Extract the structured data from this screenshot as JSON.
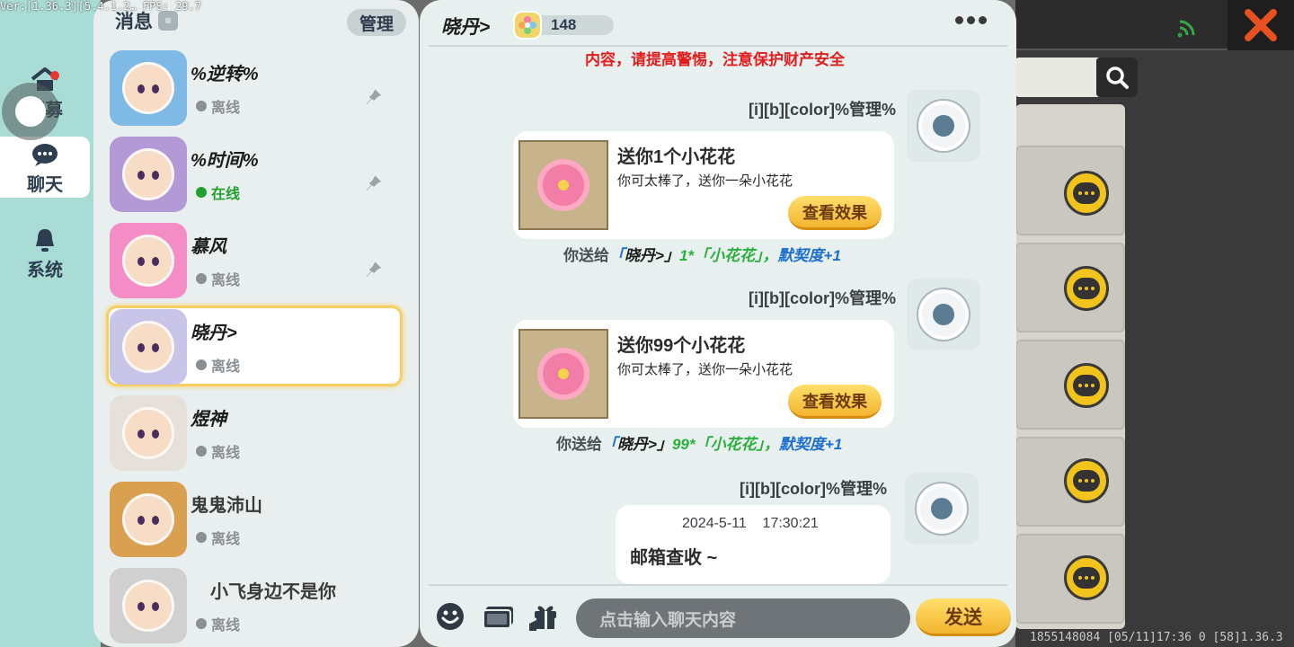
{
  "overlay": {
    "version_text": "Ver:[1.36.3][5.4.1.2… FPS: 29.7"
  },
  "left_nav": {
    "items": [
      {
        "label": "招募",
        "icon": "home-icon"
      },
      {
        "label": "聊天",
        "icon": "chat-bubble-icon",
        "active": true
      },
      {
        "label": "系统",
        "icon": "bell-icon"
      }
    ]
  },
  "contacts": {
    "title": "消息",
    "manage_label": "管理",
    "list": [
      {
        "name": "%逆转%",
        "status": "离线",
        "online": false,
        "pinned": true,
        "avatar_color": "#7fb9e6"
      },
      {
        "name": "%时间%",
        "status": "在线",
        "online": true,
        "pinned": true,
        "avatar_color": "#b39ad6"
      },
      {
        "name": "慕风",
        "status": "离线",
        "online": false,
        "pinned": true,
        "avatar_color": "#f48cc6"
      },
      {
        "name": "晓丹>",
        "status": "离线",
        "online": false,
        "pinned": false,
        "selected": true,
        "avatar_color": "#c9c5e8"
      },
      {
        "name": "煜神",
        "status": "离线",
        "online": false,
        "pinned": false,
        "avatar_color": "#e6e0da"
      },
      {
        "name": "鬼鬼沛山",
        "status": "离线",
        "online": false,
        "pinned": false,
        "avatar_color": "#d9a050"
      },
      {
        "name": "小飞身边不是你",
        "status": "离线",
        "online": false,
        "pinned": false,
        "avatar_color": "#d0d0d0"
      }
    ]
  },
  "chat": {
    "title": "晓丹>",
    "intimacy_value": "148",
    "warning": "内容，请提高警惕，注意保护财产安全",
    "messages": [
      {
        "sender": "[i][b][color]%管理%",
        "gift_title": "送你1个小花花",
        "gift_desc": "你可太棒了，送你一朵小花花",
        "button": "查看效果",
        "note": {
          "label": "你送给",
          "open": "「",
          "name": "晓丹>",
          "close": "」",
          "item": "1*「小花花」，",
          "bonus": "默契度+1"
        }
      },
      {
        "sender": "[i][b][color]%管理%",
        "gift_title": "送你99个小花花",
        "gift_desc": "你可太棒了，送你一朵小花花",
        "button": "查看效果",
        "note": {
          "label": "你送给",
          "open": "「",
          "name": "晓丹>",
          "close": "」",
          "item": "99*「小花花」，",
          "bonus": "默契度+1"
        }
      },
      {
        "sender": "[i][b][color]%管理%",
        "mail_time": "2024-5-11    17:30:21",
        "mail_text": "邮箱查收 ~"
      }
    ],
    "input_placeholder": "点击输入聊天内容",
    "send_label": "发送"
  },
  "background": {
    "footer_text": "1855148084   [05/11]17:36 0  [58]1.36.3"
  },
  "colors": {
    "warning": "#e21d1d",
    "online": "#22a02e",
    "accent_yellow": "#f3b530",
    "intimacy_blue": "#1c6fd0",
    "gift_green": "#29b03a"
  }
}
